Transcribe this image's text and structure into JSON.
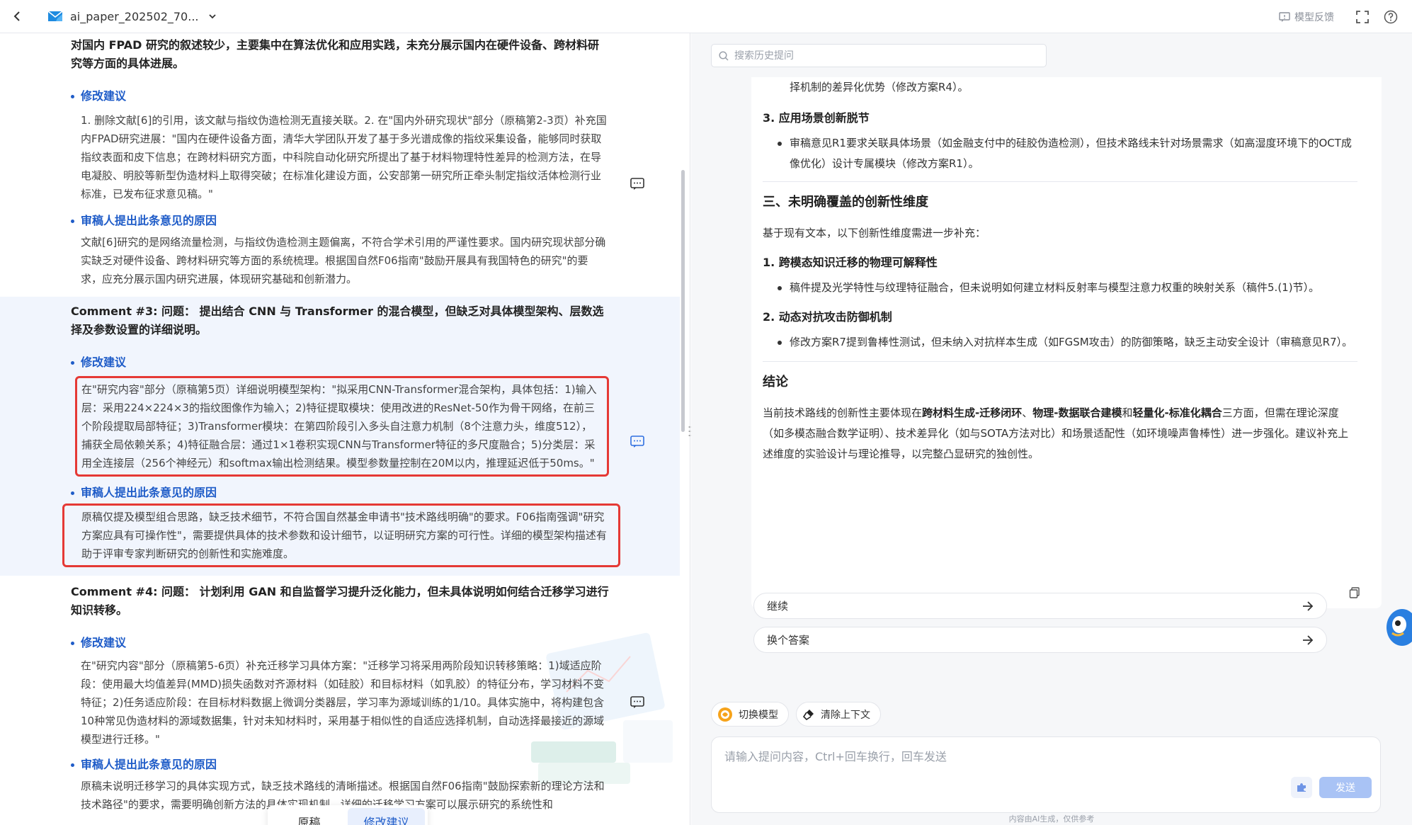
{
  "topbar": {
    "file_name": "ai_paper_202502_70...",
    "feedback_label": "模型反馈"
  },
  "left": {
    "intro_text": "对国内 FPAD 研究的叙述较少，主要集中在算法优化和应用实践，未充分展示国内在硬件设备、跨材料研究等方面的具体进展。",
    "c2": {
      "suggestion_head": "修改建议",
      "suggestion_text": "1. 删除文献[6]的引用，该文献与指纹伪造检测无直接关联。2. 在\"国内外研究现状\"部分（原稿第2-3页）补充国内FPAD研究进展：\"国内在硬件设备方面，清华大学团队开发了基于多光谱成像的指纹采集设备，能够同时获取指纹表面和皮下信息；在跨材料研究方面，中科院自动化研究所提出了基于材料物理特性差异的检测方法，在导电凝胶、明胶等新型伪造材料上取得突破；在标准化建设方面，公安部第一研究所正牵头制定指纹活体检测行业标准，已发布征求意见稿。\"",
      "reason_head": "审稿人提出此条意见的原因",
      "reason_text": "文献[6]研究的是网络流量检测，与指纹伪造检测主题偏离，不符合学术引用的严谨性要求。国内研究现状部分确实缺乏对硬件设备、跨材料研究等方面的系统梳理。根据国自然F06指南\"鼓励开展具有我国特色的研究\"的要求，应充分展示国内研究进展，体现研究基础和创新潜力。"
    },
    "c3": {
      "title": "Comment #3: 问题： 提出结合 CNN 与 Transformer 的混合模型，但缺乏对具体模型架构、层数选择及参数设置的详细说明。",
      "suggestion_head": "修改建议",
      "suggestion_text": "在\"研究内容\"部分（原稿第5页）详细说明模型架构：\"拟采用CNN-Transformer混合架构，具体包括：1)输入层：采用224×224×3的指纹图像作为输入；2)特征提取模块：使用改进的ResNet-50作为骨干网络，在前三个阶段提取局部特征；3)Transformer模块：在第四阶段引入多头自注意力机制（8个注意力头，维度512），捕获全局依赖关系；4)特征融合层：通过1×1卷积实现CNN与Transformer特征的多尺度融合；5)分类层：采用全连接层（256个神经元）和softmax输出检测结果。模型参数量控制在20M以内，推理延迟低于50ms。\"",
      "reason_head": "审稿人提出此条意见的原因",
      "reason_text": "原稿仅提及模型组合思路，缺乏技术细节，不符合国自然基金申请书\"技术路线明确\"的要求。F06指南强调\"研究方案应具有可操作性\"，需要提供具体的技术参数和设计细节，以证明研究方案的可行性。详细的模型架构描述有助于评审专家判断研究的创新性和实施难度。"
    },
    "c4": {
      "title": "Comment #4: 问题： 计划利用 GAN 和自监督学习提升泛化能力，但未具体说明如何结合迁移学习进行知识转移。",
      "suggestion_head": "修改建议",
      "suggestion_text": "在\"研究内容\"部分（原稿第5-6页）补充迁移学习具体方案：\"迁移学习将采用两阶段知识转移策略：1)域适应阶段：使用最大均值差异(MMD)损失函数对齐源材料（如硅胶）和目标材料（如乳胶）的特征分布，学习材料不变特征；2)任务适应阶段：在目标材料数据上微调分类器层，学习率为源域训练的1/10。具体实施中，将构建包含10种常见伪造材料的源域数据集，针对未知材料时，采用基于相似性的自适应选择机制，自动选择最接近的源域模型进行迁移。\"",
      "reason_head": "审稿人提出此条意见的原因",
      "reason_text": "原稿未说明迁移学习的具体实现方式，缺乏技术路线的清晰描述。根据国自然F06指南\"鼓励探索新的理论方法和技术路径\"的要求，需要明确创新方法的具体实现机制。详细的迁移学习方案可以展示研究的系统性和"
    },
    "tabs": {
      "original": "原稿",
      "revision": "修改建议"
    }
  },
  "right": {
    "search_placeholder": "搜索历史提问",
    "answer": {
      "top_cont": "择机制的差异化优势（修改方案R4）。",
      "s3_title": "3. 应用场景创新脱节",
      "s3_item": "审稿意见R1要求关联具体场景（如金融支付中的硅胶伪造检测），但技术路线未针对场景需求（如高湿度环境下的OCT成像优化）设计专属模块（修改方案R1）。",
      "h3": "三、未明确覆盖的创新性维度",
      "intro": "基于现有文本，以下创新性维度需进一步补充：",
      "d1_title": "1. 跨模态知识迁移的物理可解释性",
      "d1_item": "稿件提及光学特性与纹理特征融合，但未说明如何建立材料反射率与模型注意力权重的映射关系（稿件5.(1)节）。",
      "d2_title": "2. 动态对抗攻击防御机制",
      "d2_item": "修改方案R7提到鲁棒性测试，但未纳入对抗样本生成（如FGSM攻击）的防御策略，缺乏主动安全设计（审稿意见R7）。",
      "conclusion_title": "结论",
      "conclusion_pre": "当前技术路线的创新性主要体现在",
      "conclusion_b1": "跨材料生成-迁移闭环",
      "conclusion_sep1": "、",
      "conclusion_b2": "物理-数据联合建模",
      "conclusion_sep2": "和",
      "conclusion_b3": "轻量化-标准化耦合",
      "conclusion_post": "三方面，但需在理论深度（如多模态融合数学证明）、技术差异化（如与SOTA方法对比）和场景适配性（如环境噪声鲁棒性）进一步强化。建议补充上述维度的实验设计与理论推导，以完整凸显研究的独创性。"
    },
    "suggestions": [
      "继续",
      "换个答案"
    ],
    "tools": {
      "switch_model": "切换模型",
      "clear_context": "清除上下文"
    },
    "input_placeholder": "请输入提问内容，Ctrl+回车换行，回车发送",
    "send_label": "发送",
    "disclaimer": "内容由AI生成，仅供参考"
  }
}
